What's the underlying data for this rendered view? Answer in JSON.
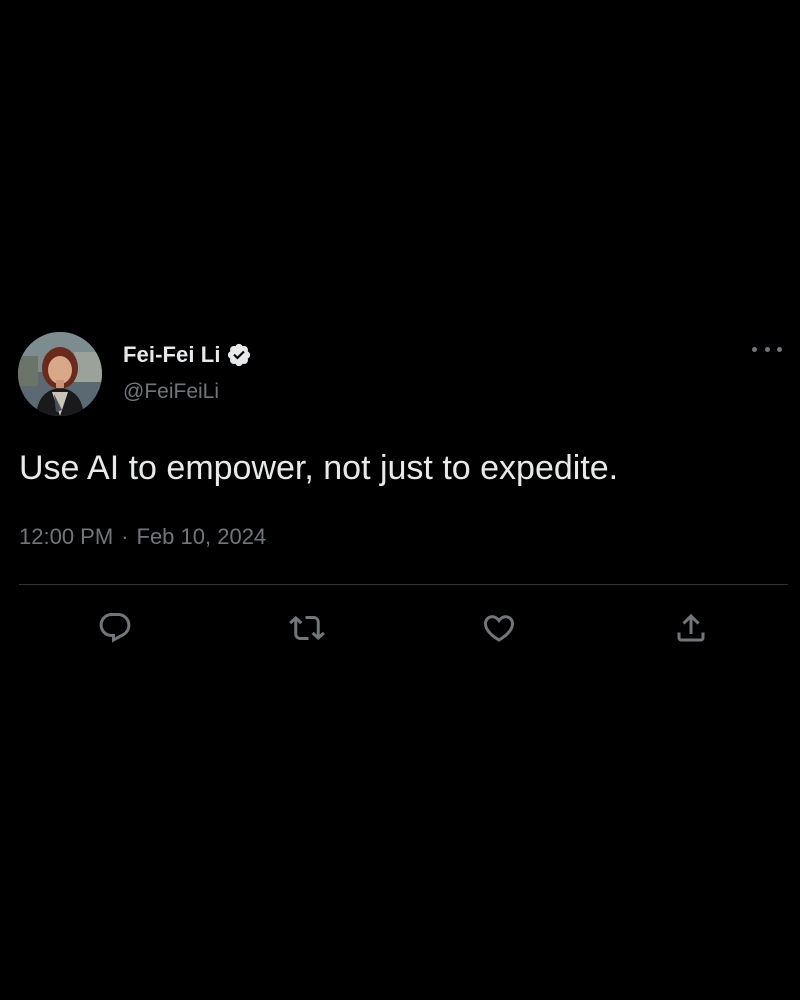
{
  "author": {
    "display_name": "Fei-Fei Li",
    "handle": "@FeiFeiLi",
    "verified": true,
    "avatar_icon": "profile-photo"
  },
  "tweet": {
    "text": "Use AI to empower, not just to expedite.",
    "time": "12:00 PM",
    "separator": "·",
    "date": "Feb 10, 2024"
  },
  "actions": [
    {
      "name": "reply",
      "icon": "speech-bubble-icon"
    },
    {
      "name": "retweet",
      "icon": "retweet-icon"
    },
    {
      "name": "like",
      "icon": "heart-icon"
    },
    {
      "name": "share",
      "icon": "share-upload-icon"
    }
  ],
  "colors": {
    "background": "#000000",
    "primary_text": "#e7e9ea",
    "secondary_text": "#71767b",
    "divider": "#2f3336",
    "icon": "#71767b"
  }
}
